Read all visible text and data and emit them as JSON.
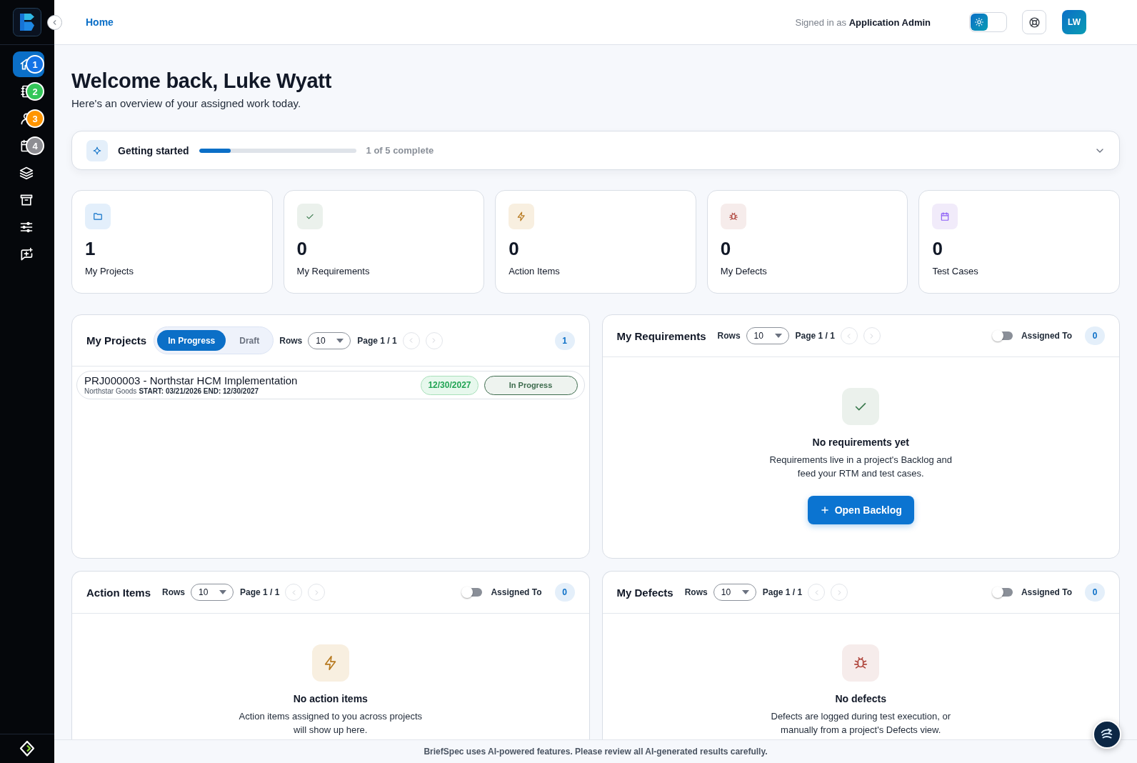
{
  "sidebar": {
    "nav_items": [
      {
        "selected": true,
        "badge": "1",
        "color": "#1473e6"
      },
      {
        "selected": false,
        "badge": "2",
        "color": "#34c759"
      },
      {
        "selected": false,
        "badge": "3",
        "color": "#ff9500"
      },
      {
        "selected": false,
        "badge": "4",
        "color": "#8e8e93"
      },
      {
        "selected": false
      },
      {
        "selected": false
      },
      {
        "selected": false
      },
      {
        "selected": false
      }
    ]
  },
  "header": {
    "breadcrumb": "Home",
    "signed_in": "Signed in as **Application Admin**",
    "theme_toggle": {
      "dark": false
    },
    "avatar_initials": "LW"
  },
  "welcome": {
    "title": "Welcome back, Luke Wyatt",
    "subtitle": "Here's an overview of your assigned work today."
  },
  "getting_started": {
    "title": "Getting started",
    "level": 0.2,
    "progress_text": "1 of 5 complete",
    "expanded": false
  },
  "stats": [
    {
      "value": "1",
      "label": "My Projects"
    },
    {
      "value": "0",
      "label": "My Requirements"
    },
    {
      "value": "0",
      "label": "Action Items"
    },
    {
      "value": "0",
      "label": "My Defects"
    },
    {
      "value": "0",
      "label": "Test Cases"
    }
  ],
  "projects_panel": {
    "title": "My Projects",
    "tabs": [
      {
        "label": "In Progress",
        "selected": true
      },
      {
        "label": "Draft",
        "selected": false
      }
    ],
    "rows_label": "Rows",
    "rows_value": "10",
    "pager": {
      "page_text": "Page 1 / 1",
      "previous_disabled": true,
      "next_disabled": true
    },
    "count": "1",
    "projects": [
      {
        "title": "PRJ000003 - Northstar HCM Implementation",
        "client": "Northstar Goods",
        "dates": "START: 03/21/2026 END: 12/30/2027",
        "due_date": "12/30/2027",
        "status": "In Progress"
      }
    ]
  },
  "requirements_panel": {
    "title": "My Requirements",
    "rows_label": "Rows",
    "rows_value": "10",
    "pager": {
      "page_text": "Page 1 / 1",
      "previous_disabled": true,
      "next_disabled": true
    },
    "assigned_to": {
      "label": "Assigned To",
      "on": false
    },
    "count": "0",
    "empty_state": {
      "title": "No requirements yet",
      "text": "Requirements live in a project's Backlog and feed your RTM and test cases.",
      "button": "Open Backlog"
    }
  },
  "action_items_panel": {
    "title": "Action Items",
    "rows_label": "Rows",
    "rows_value": "10",
    "pager": {
      "page_text": "Page 1 / 1",
      "previous_disabled": true,
      "next_disabled": true
    },
    "assigned_to": {
      "label": "Assigned To",
      "on": false
    },
    "count": "0",
    "empty_state": {
      "title": "No action items",
      "text": "Action items assigned to you across projects will show up here."
    }
  },
  "defects_panel": {
    "title": "My Defects",
    "rows_label": "Rows",
    "rows_value": "10",
    "pager": {
      "page_text": "Page 1 / 1",
      "previous_disabled": true,
      "next_disabled": true
    },
    "assigned_to": {
      "label": "Assigned To",
      "on": false
    },
    "count": "0",
    "empty_state": {
      "title": "No defects",
      "text": "Defects are logged during test execution, or manually from a project's Defects view."
    }
  },
  "footer": {
    "notice": "BriefSpec uses AI-powered features. Please review all AI-generated results carefully."
  }
}
